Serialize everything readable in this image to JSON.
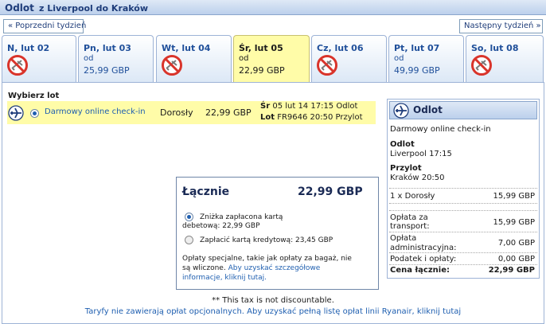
{
  "header": {
    "title": "Odlot",
    "route": "z Liverpool do Kraków"
  },
  "week_nav": {
    "prev_label": "« Poprzedni tydzień",
    "next_label": "Następny tydzień »"
  },
  "days": [
    {
      "label": "N, lut 02",
      "od": "",
      "price": "",
      "available": false,
      "selected": false
    },
    {
      "label": "Pn, lut 03",
      "od": "od",
      "price": "25,99 GBP",
      "available": true,
      "selected": false
    },
    {
      "label": "Wt, lut 04",
      "od": "",
      "price": "",
      "available": false,
      "selected": false
    },
    {
      "label": "Śr, lut 05",
      "od": "od",
      "price": "22,99 GBP",
      "available": true,
      "selected": true
    },
    {
      "label": "Cz, lut 06",
      "od": "",
      "price": "",
      "available": false,
      "selected": false
    },
    {
      "label": "Pt, lut 07",
      "od": "od",
      "price": "49,99 GBP",
      "available": true,
      "selected": false
    },
    {
      "label": "So, lut 08",
      "od": "",
      "price": "",
      "available": false,
      "selected": false
    }
  ],
  "selection": {
    "title": "Wybierz lot",
    "fare_name": "Darmowy online check-in",
    "pax_type": "Dorosły",
    "price": "22,99 GBP",
    "dep_day": "Śr",
    "dep_time": "05 lut 14 17:15 Odlot",
    "flight_prefix": "Lot",
    "flight_info": "FR9646 20:50 Przylot"
  },
  "summary": {
    "label": "Łącznie",
    "total": "22,99 GBP",
    "debit_l1": "Zniżka zapłacona kartą",
    "debit_l2": "debetową: 22,99 GBP",
    "credit": "Zapłacić kartą kredytową: 23,45 GBP",
    "note_l1": "Opłaty specjalne, takie jak opłaty za bagaż, nie",
    "note_l2a": "są wliczone.",
    "note_link_a": "Aby uzyskać szczegółowe",
    "note_link_b": "informacje, kliknij tutaj."
  },
  "right_summary": {
    "title": "Odlot",
    "fare": "Darmowy online check-in",
    "dep_label": "Odlot",
    "dep_value": "Liverpool 17:15",
    "arr_label": "Przylot",
    "arr_value": "Kraków 20:50",
    "pax_line": "1 x Dorosły",
    "pax_price": "15,99 GBP",
    "transport_l1": "Opłata za",
    "transport_l2": "transport:",
    "transport_price": "15,99 GBP",
    "admin_l1": "Opłata",
    "admin_l2": "administracyjna:",
    "admin_price": "7,00 GBP",
    "tax_label": "Podatek i opłaty:",
    "tax_price": "0,00 GBP",
    "total_label": "Cena łącznie:",
    "total_price": "22,99 GBP"
  },
  "footer": {
    "tax_note": "** This tax is not discountable.",
    "fees_link": "Taryfy nie zawierają opłat opcjonalnych. Aby uzyskać pełną listę opłat linii Ryanair, kliknij tutaj"
  },
  "colors": {
    "accent": "#1f5fb0",
    "selected_day": "#fffca8",
    "header_bg": "#bcd0ec"
  },
  "icons": {
    "plane": "plane-icon",
    "no_flight": "no-flight-icon"
  }
}
